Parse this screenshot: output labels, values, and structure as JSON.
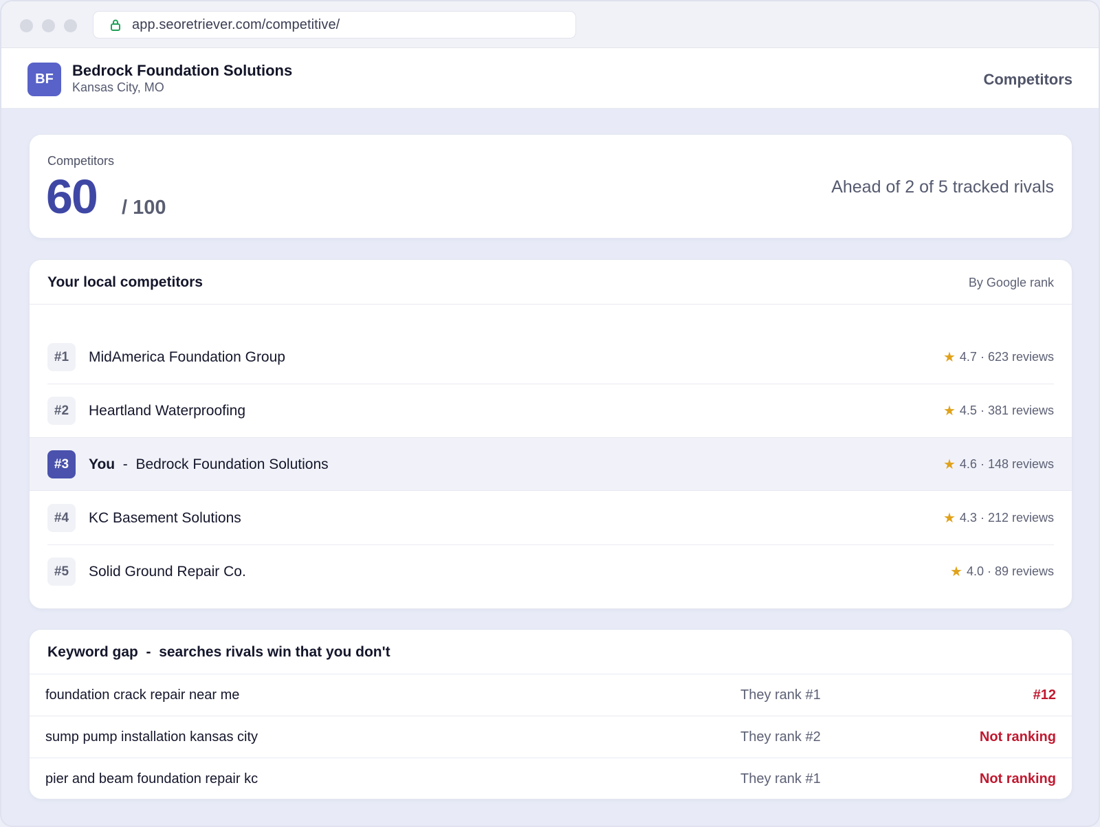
{
  "browser": {
    "url": "app.seoretriever.com/competitive/"
  },
  "header": {
    "avatar_initials": "BF",
    "business_name": "Bedrock Foundation Solutions",
    "location": "Kansas City, MO",
    "nav_current": "Competitors"
  },
  "score": {
    "label": "Competitors",
    "value": "60",
    "max": "/ 100",
    "summary": "Ahead of 2 of 5 tracked rivals"
  },
  "competitors": {
    "title": "Your local competitors",
    "sort_label": "By Google rank",
    "you_label": "You",
    "rows": [
      {
        "rank": "#1",
        "name": "MidAmerica Foundation Group",
        "meta": "4.7 · 623 reviews"
      },
      {
        "rank": "#2",
        "name": "Heartland Waterproofing",
        "meta": "4.5 · 381 reviews"
      },
      {
        "rank": "#3",
        "name": "Bedrock Foundation Solutions",
        "meta": "4.6 · 148 reviews"
      },
      {
        "rank": "#4",
        "name": "KC Basement Solutions",
        "meta": "4.3 · 212 reviews"
      },
      {
        "rank": "#5",
        "name": "Solid Ground Repair Co.",
        "meta": "4.0 · 89 reviews"
      }
    ]
  },
  "keyword_gap": {
    "title": "Keyword gap",
    "subtitle": "searches rivals win that you don't",
    "rows": [
      {
        "keyword": "foundation crack repair near me",
        "their_rank": "They rank #1",
        "your_rank": "#12"
      },
      {
        "keyword": "sump pump installation kansas city",
        "their_rank": "They rank #2",
        "your_rank": "Not ranking"
      },
      {
        "keyword": "pier and beam foundation repair kc",
        "their_rank": "They rank #1",
        "your_rank": "Not ranking"
      }
    ]
  },
  "colors": {
    "accent": "#4a52ad",
    "score": "#3f47a5",
    "star": "#e0a21b",
    "alert": "#c0182f"
  }
}
